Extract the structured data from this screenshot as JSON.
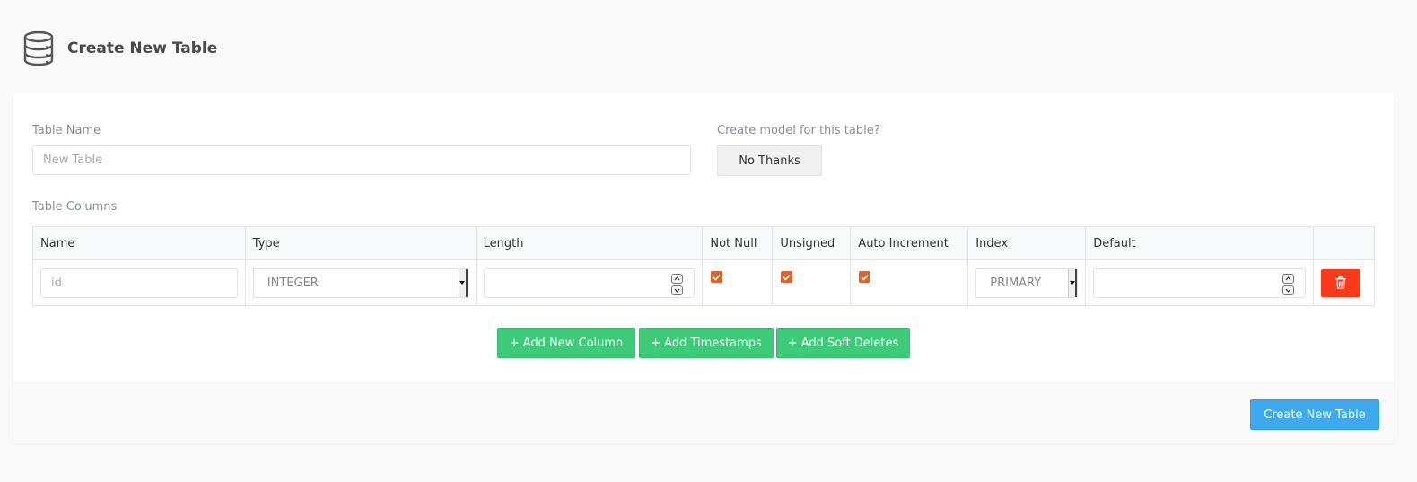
{
  "header": {
    "title": "Create New Table",
    "icon": "database-icon"
  },
  "form": {
    "table_name_label": "Table Name",
    "table_name_placeholder": "New Table",
    "model_label": "Create model for this table?",
    "model_button": "No Thanks",
    "columns_label": "Table Columns"
  },
  "columns_table": {
    "headers": [
      "Name",
      "Type",
      "Length",
      "Not Null",
      "Unsigned",
      "Auto Increment",
      "Index",
      "Default",
      ""
    ],
    "rows": [
      {
        "name_placeholder": "id",
        "type": "INTEGER",
        "length": "",
        "not_null": true,
        "unsigned": true,
        "auto_increment": true,
        "index": "PRIMARY",
        "default": ""
      }
    ]
  },
  "actions": {
    "add_column": "+ Add New Column",
    "add_timestamps": "+ Add Timestamps",
    "add_soft_deletes": "+ Add Soft Deletes",
    "create_table": "Create New Table"
  },
  "colors": {
    "checkbox": "#d5662f",
    "delete": "#fa3a1a",
    "green": "#3ecb79",
    "blue": "#3fa9ee"
  }
}
